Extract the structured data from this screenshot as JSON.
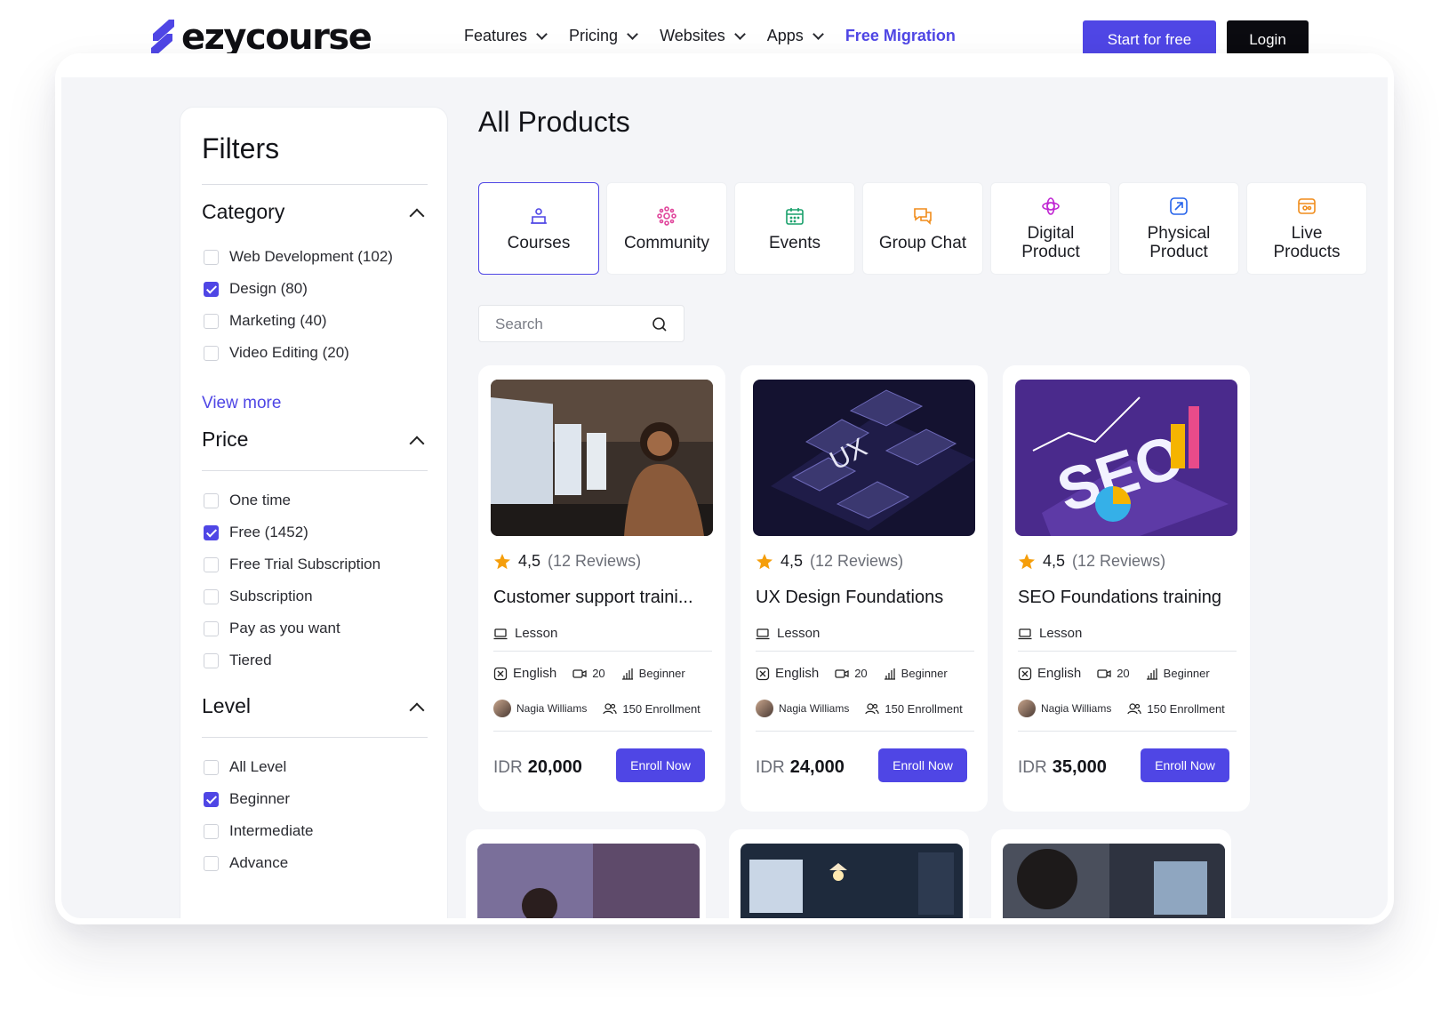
{
  "nav": {
    "logo_text": "ezycourse",
    "items": [
      {
        "label": "Features"
      },
      {
        "label": "Pricing"
      },
      {
        "label": "Websites"
      },
      {
        "label": "Apps"
      }
    ],
    "free_migration": "Free Migration",
    "start_label": "Start for free",
    "login_label": "Login"
  },
  "filters": {
    "title": "Filters",
    "category": {
      "title": "Category",
      "options": [
        {
          "label": "Web Development (102)",
          "checked": false
        },
        {
          "label": "Design (80)",
          "checked": true
        },
        {
          "label": "Marketing (40)",
          "checked": false
        },
        {
          "label": "Video Editing (20)",
          "checked": false
        }
      ],
      "view_more": "View more"
    },
    "price": {
      "title": "Price",
      "options": [
        {
          "label": "One time",
          "checked": false
        },
        {
          "label": "Free (1452)",
          "checked": true
        },
        {
          "label": "Free Trial Subscription",
          "checked": false
        },
        {
          "label": "Subscription",
          "checked": false
        },
        {
          "label": "Pay as you want",
          "checked": false
        },
        {
          "label": "Tiered",
          "checked": false
        }
      ]
    },
    "level": {
      "title": "Level",
      "options": [
        {
          "label": "All Level",
          "checked": false
        },
        {
          "label": "Beginner",
          "checked": true
        },
        {
          "label": "Intermediate",
          "checked": false
        },
        {
          "label": "Advance",
          "checked": false
        }
      ]
    }
  },
  "main": {
    "title": "All Products",
    "tabs": [
      {
        "label": "Courses",
        "icon": "course-icon",
        "color": "#4f46e5"
      },
      {
        "label": "Community",
        "icon": "community-icon",
        "color": "#e0459b"
      },
      {
        "label": "Events",
        "icon": "calendar-icon",
        "color": "#19a06b"
      },
      {
        "label": "Group Chat",
        "icon": "chat-icon",
        "color": "#f08c1a"
      },
      {
        "label": "Digital\nProduct",
        "icon": "digital-icon",
        "color": "#c026d3"
      },
      {
        "label": "Physical\nProduct",
        "icon": "physical-icon",
        "color": "#2563eb"
      },
      {
        "label": "Live\nProducts",
        "icon": "live-icon",
        "color": "#f08c1a"
      }
    ],
    "search_placeholder": "Search"
  },
  "cards": [
    {
      "rating": "4,5",
      "reviews": "(12 Reviews)",
      "title": "Customer support traini...",
      "type": "Lesson",
      "language": "English",
      "videos": "20",
      "level": "Beginner",
      "author": "Nagia Williams",
      "enrollment": "150 Enrollment",
      "currency": "IDR",
      "price": "20,000",
      "cta": "Enroll Now"
    },
    {
      "rating": "4,5",
      "reviews": "(12 Reviews)",
      "title": "UX Design Foundations",
      "type": "Lesson",
      "language": "English",
      "videos": "20",
      "level": "Beginner",
      "author": "Nagia Williams",
      "enrollment": "150 Enrollment",
      "currency": "IDR",
      "price": "24,000",
      "cta": "Enroll Now"
    },
    {
      "rating": "4,5",
      "reviews": "(12 Reviews)",
      "title": "SEO Foundations training",
      "type": "Lesson",
      "language": "English",
      "videos": "20",
      "level": "Beginner",
      "author": "Nagia Williams",
      "enrollment": "150 Enrollment",
      "currency": "IDR",
      "price": "35,000",
      "cta": "Enroll Now"
    }
  ],
  "colors": {
    "accent": "#4f46e5",
    "dark": "#0b0b10",
    "star": "#f59e0b"
  }
}
